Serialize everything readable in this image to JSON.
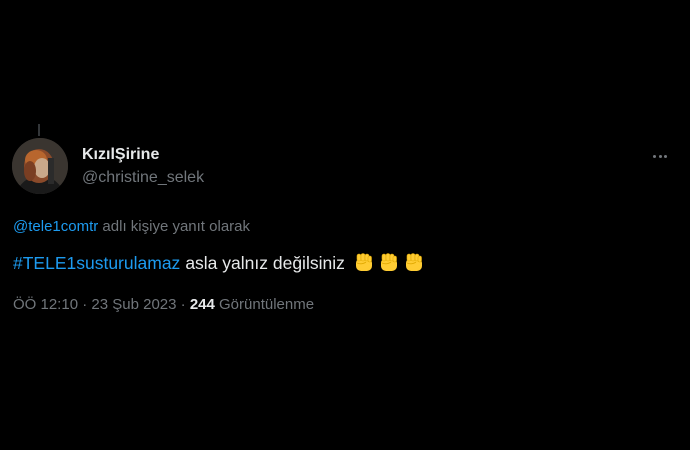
{
  "author": {
    "display_name": "KızılŞirine",
    "handle": "@christine_selek"
  },
  "reply": {
    "mention": "@tele1comtr",
    "suffix": " adlı kişiye yanıt olarak"
  },
  "tweet": {
    "hashtag": "#TELE1susturulamaz",
    "text": "asla yalnız değilsiniz",
    "emojis": [
      "raised-fist-emoji",
      "raised-fist-emoji",
      "raised-fist-emoji"
    ]
  },
  "meta": {
    "time": "ÖÖ 12:10",
    "separator1": " · ",
    "date": "23 Şub 2023",
    "separator2": " · ",
    "views_count": "244",
    "views_label": " Görüntülenme"
  },
  "icons": {
    "more": "more-horizontal-icon"
  },
  "colors": {
    "background": "#000000",
    "text_primary": "#e7e9ea",
    "text_secondary": "#71767b",
    "link": "#1d9bf0"
  }
}
